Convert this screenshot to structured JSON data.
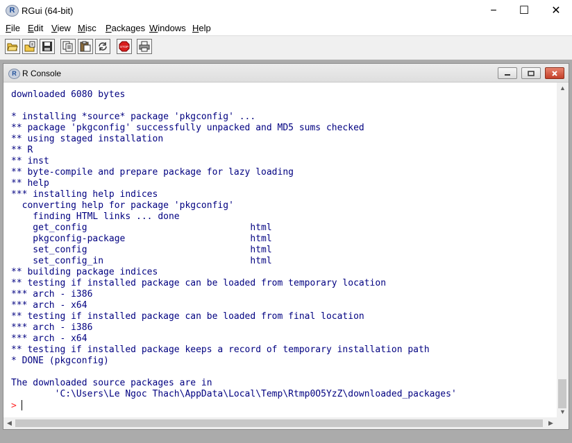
{
  "window": {
    "title": "RGui (64-bit)",
    "logo_letter": "R",
    "controls": {
      "minimize": "−",
      "maximize": "☐",
      "close": "✕"
    }
  },
  "menu": {
    "items": [
      {
        "label": "File",
        "hotkey": "F",
        "rest": "ile"
      },
      {
        "label": "Edit",
        "hotkey": "E",
        "rest": "dit"
      },
      {
        "label": "View",
        "hotkey": "V",
        "rest": "iew"
      },
      {
        "label": "Misc",
        "hotkey": "M",
        "rest": "isc"
      },
      {
        "label": "Packages",
        "hotkey": "P",
        "rest": "ackages"
      },
      {
        "label": "Windows",
        "hotkey": "W",
        "rest": "indows"
      },
      {
        "label": "Help",
        "hotkey": "H",
        "rest": "elp"
      }
    ]
  },
  "toolbar": {
    "icons": [
      "open-script-icon",
      "load-workspace-icon",
      "save-icon",
      "copy-icon",
      "paste-icon",
      "copy-paste-icon",
      "stop-icon",
      "print-icon"
    ],
    "stop_label": "STOP"
  },
  "console": {
    "title": "R Console",
    "logo_letter": "R",
    "output_lines": [
      "downloaded 6080 bytes",
      "",
      "* installing *source* package 'pkgconfig' ...",
      "** package 'pkgconfig' successfully unpacked and MD5 sums checked",
      "** using staged installation",
      "** R",
      "** inst",
      "** byte-compile and prepare package for lazy loading",
      "** help",
      "*** installing help indices",
      "  converting help for package 'pkgconfig'",
      "    finding HTML links ... done",
      "    get_config                              html",
      "    pkgconfig-package                       html",
      "    set_config                              html",
      "    set_config_in                           html",
      "** building package indices",
      "** testing if installed package can be loaded from temporary location",
      "*** arch - i386",
      "*** arch - x64",
      "** testing if installed package can be loaded from final location",
      "*** arch - i386",
      "*** arch - x64",
      "** testing if installed package keeps a record of temporary installation path",
      "* DONE (pkgconfig)",
      "",
      "The downloaded source packages are in",
      "        'C:\\Users\\Le Ngoc Thach\\AppData\\Local\\Temp\\Rtmp0O5YzZ\\downloaded_packages'"
    ],
    "prompt": ">"
  },
  "colors": {
    "output_text": "#000080",
    "prompt": "#ff2a2a",
    "mdi_background": "#ababab"
  }
}
